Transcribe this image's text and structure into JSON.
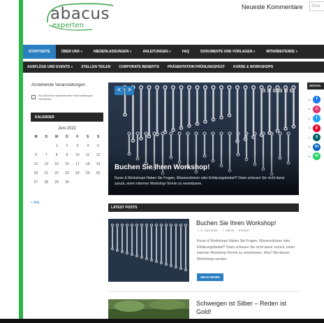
{
  "header": {
    "logo_main": "abacus",
    "logo_sub": "experten",
    "top_link": "Neueste Kommentare",
    "search_placeholder": "Sear"
  },
  "nav": {
    "row1": [
      {
        "label": "STARTSEITE",
        "active": true
      },
      {
        "label": "ÜBER UNS »"
      },
      {
        "label": "NIEDERLASSUNGEN »"
      },
      {
        "label": "ANLEITUNGEN »"
      },
      {
        "label": "FAQ"
      },
      {
        "label": "DOKUMENTE UND VORLAGEN »"
      },
      {
        "label": "MITARBEITENDE »"
      }
    ],
    "row2": [
      {
        "label": "AUSFLÜGE UND EVENTS »"
      },
      {
        "label": "STELLEN TEILEN"
      },
      {
        "label": "CORPORATE BENEFITS"
      },
      {
        "label": "PRÄSENTATION FRÜHLINGSFEST"
      },
      {
        "label": "KURSE & WORKSHOPS"
      }
    ]
  },
  "sidebar": {
    "events_title": "Anstehende Veranstaltungen",
    "events_empty": "Es sind keine anstehenden Veranstaltungen vorhanden.",
    "calendar_heading": "KALENDER",
    "calendar_month": "Juni 2022",
    "weekdays": [
      "M",
      "D",
      "M",
      "D",
      "F",
      "S",
      "S"
    ],
    "days": [
      "",
      "",
      "1",
      "2",
      "3",
      "4",
      "5",
      "6",
      "7",
      "8",
      "9",
      "10",
      "11",
      "12",
      "13",
      "14",
      "15",
      "16",
      "17",
      "18",
      "19",
      "20",
      "21",
      "22",
      "23",
      "24",
      "25",
      "26",
      "27",
      "28",
      "29",
      "30",
      "",
      "",
      ""
    ],
    "prev_link": "« Mai"
  },
  "slider": {
    "title": "Buchen Sie Ihren Workshop!",
    "text": "Kurse & Workshops Haben Sie Fragen, Wissenslücken oder Erklärungsbedarf? Dann scheuen Sie nicht davor zurück, einen internen Workshop-Termin zu vereinbaren.",
    "prev": "<",
    "next": ">"
  },
  "latest": {
    "heading": "LATEST POSTS",
    "post1": {
      "title": "Buchen Sie Ihren Workshop!",
      "date": "2. Juni 2022",
      "author": "admin",
      "category": "News",
      "excerpt": "Kurse & Workshops Haben Sie Fragen, Wissenslücken oder Erklärungsbedarf? Dann scheuen Sie nicht davor zurück, einen internen Workshop-Termin zu vereinbaren. Was? Bei diesen Workshops werden",
      "read_more": "READ MORE"
    },
    "post2": {
      "title": "Schweigen ist Silber – Reden ist Gold!"
    }
  },
  "social": {
    "heading": "SOCIAL",
    "icons": [
      {
        "name": "facebook-icon",
        "glyph": "f",
        "color": "#1877f2"
      },
      {
        "name": "instagram-icon",
        "glyph": "◎",
        "color": "#e1306c"
      },
      {
        "name": "twitter-icon",
        "glyph": "t",
        "color": "#1da1f2"
      },
      {
        "name": "pinterest-icon",
        "glyph": "p",
        "color": "#e60023"
      },
      {
        "name": "xing-icon",
        "glyph": "x",
        "color": "#026466"
      },
      {
        "name": "linkedin-icon",
        "glyph": "in",
        "color": "#0a66c2"
      },
      {
        "name": "whatsapp-icon",
        "glyph": "w",
        "color": "#25d366"
      }
    ]
  },
  "colors": {
    "accent": "#2a7fc0",
    "brand_green": "#2db34a",
    "dark_bar": "#262626"
  }
}
